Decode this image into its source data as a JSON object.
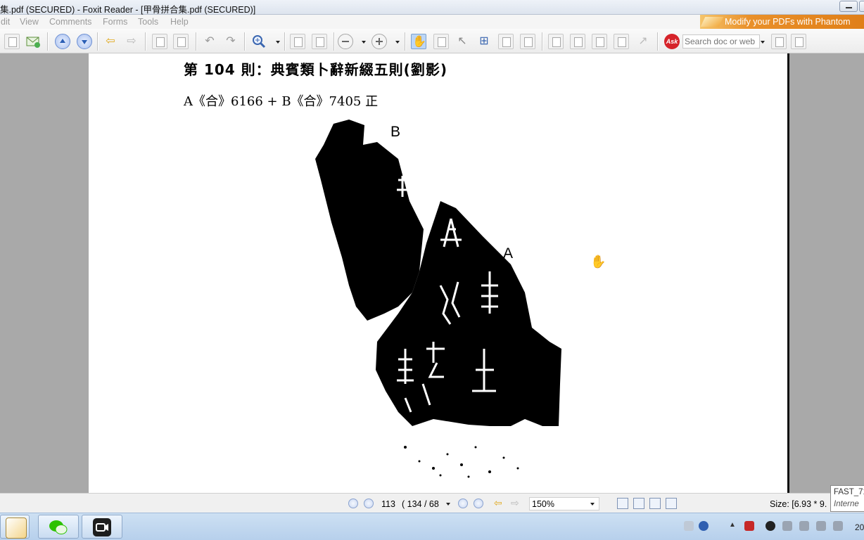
{
  "window": {
    "title": "集.pdf (SECURED) - Foxit Reader - [甲骨拼合集.pdf (SECURED)]"
  },
  "menu": {
    "items": [
      "dit",
      "View",
      "Comments",
      "Forms",
      "Tools",
      "Help"
    ]
  },
  "ad": {
    "text": "Modify your PDFs with Phantom"
  },
  "toolbar": {
    "ask_logo": "Ask",
    "search_placeholder": "Search doc or web",
    "accent": "#4a7fd0"
  },
  "page": {
    "heading": "第 104 則：典賓類卜辭新綴五則(劉影)",
    "subheading": "A《合》6166 + B《合》7405 正",
    "fragment_labels": [
      "B",
      "A"
    ]
  },
  "status": {
    "page_current": "113",
    "page_info": "( 134 / 68",
    "zoom": "150%",
    "size": "Size: [6.93 * 9."
  },
  "tooltip": {
    "line1": "FAST_71",
    "line2": "Interne"
  },
  "taskbar": {
    "apps": [
      "notepad",
      "wechat",
      "video-meeting"
    ],
    "clock": "20"
  }
}
